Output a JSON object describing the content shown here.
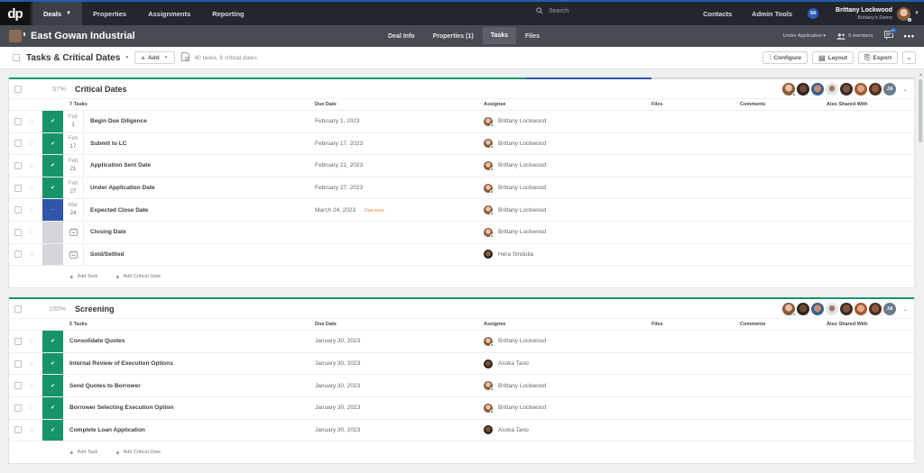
{
  "topnav": {
    "logo": "dp",
    "items": [
      {
        "label": "Deals",
        "active": true,
        "has_caret": true
      },
      {
        "label": "Properties"
      },
      {
        "label": "Assignments"
      },
      {
        "label": "Reporting"
      }
    ],
    "search_placeholder": "Search",
    "right_items": [
      "Contacts",
      "Admin Tools"
    ],
    "notification_count": "54",
    "user": {
      "name": "Brittany Lockwood",
      "subtitle": "Brittany's Demo"
    }
  },
  "deal": {
    "title": "East Gowan Industrial",
    "tabs": [
      {
        "label": "Deal Info"
      },
      {
        "label": "Properties (1)"
      },
      {
        "label": "Tasks",
        "active": true
      },
      {
        "label": "Files"
      }
    ],
    "status": "Under Application",
    "members": "9 members",
    "chat_badge": "9+"
  },
  "toolbar": {
    "title": "Tasks & Critical Dates",
    "add_label": "Add",
    "count_text": "40 tasks, 8 critical dates",
    "configure_label": "Configure",
    "layout_label": "Layout",
    "export_label": "Export"
  },
  "colors": {
    "done": "#17936c",
    "in_progress": "#2f56a8",
    "todo": "#d3d5d8",
    "due_soon": "#e87b3a"
  },
  "columns": {
    "due_date": "Due Date",
    "assignee": "Assignee",
    "files": "Files",
    "comments": "Comments",
    "shared": "Also Shared With"
  },
  "sections": [
    {
      "percent": "57%",
      "progress": {
        "done": 0.57,
        "in_progress": 0.14
      },
      "title": "Critical Dates",
      "task_count": "7 Tasks",
      "shared_initials": "JA",
      "tasks": [
        {
          "status": "done",
          "month": "Feb",
          "day": "1",
          "name": "Begin Due Diligence",
          "due": "February 1, 2023",
          "assignee": "Brittany Lockwood"
        },
        {
          "status": "done",
          "month": "Feb",
          "day": "17",
          "name": "Submit to LC",
          "due": "February 17, 2023",
          "assignee": "Brittany Lockwood"
        },
        {
          "status": "done",
          "month": "Feb",
          "day": "21",
          "name": "Application Sent Date",
          "due": "February 21, 2023",
          "assignee": "Brittany Lockwood"
        },
        {
          "status": "done",
          "month": "Feb",
          "day": "27",
          "name": "Under Application Date",
          "due": "February 27, 2023",
          "assignee": "Brittany Lockwood"
        },
        {
          "status": "in_progress",
          "month": "Mar",
          "day": "24",
          "name": "Expected Close Date",
          "due": "March 24, 2023",
          "due_flag": "Due soon",
          "assignee": "Brittany Lockwood"
        },
        {
          "status": "todo",
          "calendar": true,
          "name": "Closing Date",
          "due": "",
          "assignee": "Brittany Lockwood"
        },
        {
          "status": "todo",
          "calendar": true,
          "name": "Sold/Settled",
          "due": "",
          "assignee": "Hera Sindulla"
        }
      ],
      "add_task": "Add Task",
      "add_critical_date": "Add Critical Date"
    },
    {
      "percent": "100%",
      "progress": {
        "done": 1.0,
        "in_progress": 0
      },
      "title": "Screening",
      "task_count": "5 Tasks",
      "shared_initials": "JA",
      "tasks": [
        {
          "status": "done",
          "name": "Consolidate Quotes",
          "due": "January 30, 2023",
          "assignee": "Brittany Lockwood"
        },
        {
          "status": "done",
          "name": "Internal Review of Execution Options",
          "due": "January 30, 2023",
          "assignee": "Asoka Tano"
        },
        {
          "status": "done",
          "name": "Send Quotes to Borrower",
          "due": "January 30, 2023",
          "assignee": "Brittany Lockwood"
        },
        {
          "status": "done",
          "name": "Borrower Selecting Execution Option",
          "due": "January 30, 2023",
          "assignee": "Brittany Lockwood"
        },
        {
          "status": "done",
          "name": "Complete Loan Application",
          "due": "January 30, 2023",
          "assignee": "Asoka Tano"
        }
      ],
      "add_task": "Add Task",
      "add_critical_date": "Add Critical Date"
    }
  ]
}
